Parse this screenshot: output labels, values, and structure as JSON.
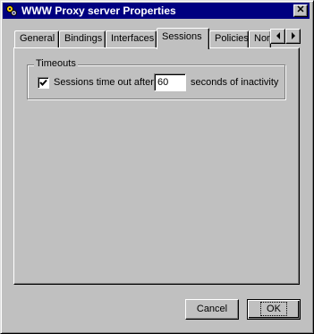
{
  "window": {
    "title": "WWW Proxy server Properties",
    "close_glyph": "✕"
  },
  "tabs": [
    {
      "label": "General",
      "active": false
    },
    {
      "label": "Bindings",
      "active": false
    },
    {
      "label": "Interfaces",
      "active": false
    },
    {
      "label": "Sessions",
      "active": true
    },
    {
      "label": "Policies",
      "active": false
    },
    {
      "label": "Nor",
      "active": false
    }
  ],
  "timeouts": {
    "group_label": "Timeouts",
    "checkbox_checked": true,
    "label_before": "Sessions time out after",
    "value": "60",
    "label_after": "seconds of inactivity"
  },
  "buttons": {
    "cancel": "Cancel",
    "ok": "OK"
  },
  "icons": {
    "title": "proxy-gears-icon",
    "scroll_left": "left-arrow-icon",
    "scroll_right": "right-arrow-icon"
  }
}
